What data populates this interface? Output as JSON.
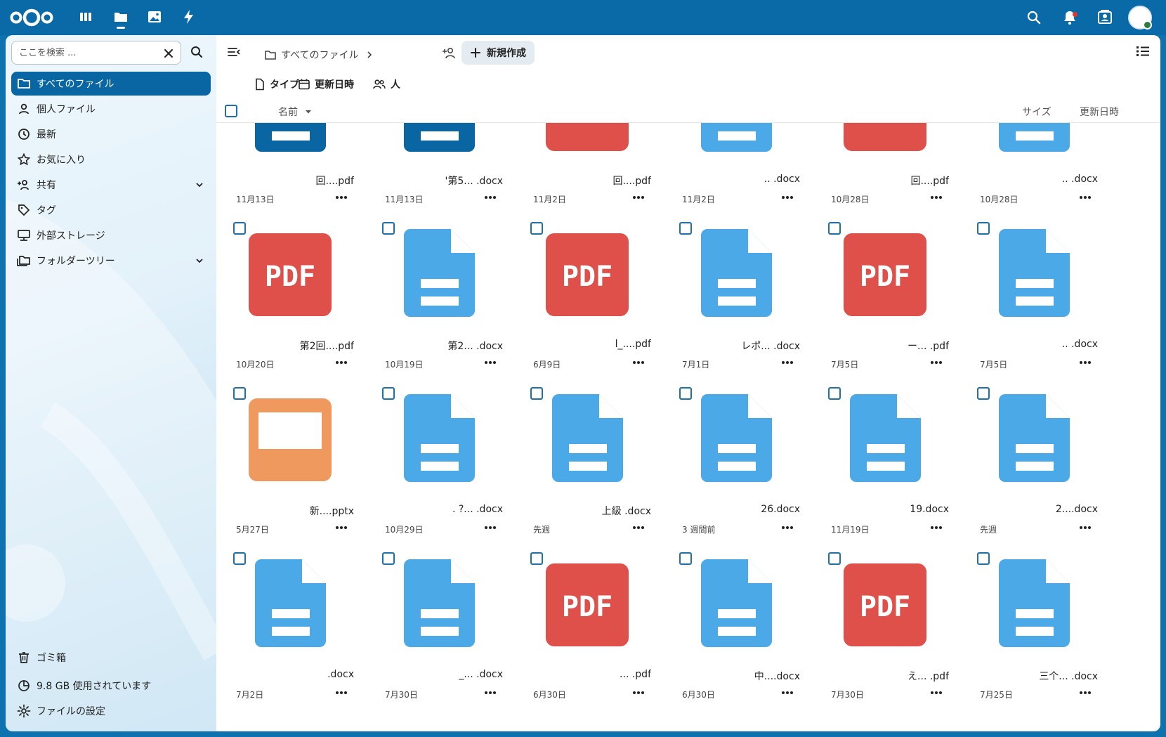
{
  "header": {
    "apps": [
      "dashboard-app",
      "files-app",
      "photos-app",
      "activity-app"
    ],
    "colors": {
      "header": "#0a6aa8",
      "accent": "#0a66a2",
      "pdf": "#e0504a",
      "doc": "#4aa9e6",
      "slide": "#f0995f"
    }
  },
  "search": {
    "placeholder": "ここを検索 ..."
  },
  "sidebar": {
    "items": [
      {
        "label": "すべてのファイル"
      },
      {
        "label": "個人ファイル"
      },
      {
        "label": "最新"
      },
      {
        "label": "お気に入り"
      },
      {
        "label": "共有"
      },
      {
        "label": "タグ"
      },
      {
        "label": "外部ストレージ"
      },
      {
        "label": "フォルダーツリー"
      }
    ],
    "trash": "ゴミ箱",
    "quota": "9.8 GB 使用されています",
    "settings": "ファイルの設定"
  },
  "toolbar": {
    "breadcrumb_root": "すべてのファイル",
    "new_label": "新規作成"
  },
  "filters": {
    "type": "タイプ",
    "modified": "更新日時",
    "people": "人"
  },
  "columns": {
    "name": "名前",
    "size": "サイズ",
    "modified": "更新日時"
  },
  "files": [
    {
      "type": "doc-dark",
      "name": "回....pdf",
      "date": "11月13日"
    },
    {
      "type": "doc-dark",
      "name": "'第5... .docx",
      "date": "11月13日"
    },
    {
      "type": "pdf",
      "name": "回....pdf",
      "date": "11月2日"
    },
    {
      "type": "doc",
      "name": ".. .docx",
      "date": "11月2日"
    },
    {
      "type": "pdf",
      "name": "回....pdf",
      "date": "10月28日"
    },
    {
      "type": "doc",
      "name": ".. .docx",
      "date": "10月28日"
    },
    {
      "type": "pdf",
      "name": "第2回....pdf",
      "date": "10月20日"
    },
    {
      "type": "doc",
      "name": "第2... .docx",
      "date": "10月19日"
    },
    {
      "type": "pdf",
      "name": "l_....pdf",
      "date": "6月9日"
    },
    {
      "type": "doc",
      "name": "レポ... .docx",
      "date": "7月1日"
    },
    {
      "type": "pdf",
      "name": "ー... .pdf",
      "date": "7月5日"
    },
    {
      "type": "doc",
      "name": ".. .docx",
      "date": "7月5日"
    },
    {
      "type": "slide",
      "name": "新....pptx",
      "date": "5月27日"
    },
    {
      "type": "doc",
      "name": ".       ?... .docx",
      "date": "10月29日"
    },
    {
      "type": "doc",
      "name": "上級                  .docx",
      "date": "先週"
    },
    {
      "type": "doc",
      "name": "26.docx",
      "date": "3 週間前"
    },
    {
      "type": "doc",
      "name": "19.docx",
      "date": "11月19日"
    },
    {
      "type": "doc",
      "name": "2....docx",
      "date": "先週"
    },
    {
      "type": "doc",
      "name": ".docx",
      "date": "7月2日"
    },
    {
      "type": "doc",
      "name": "_... .docx",
      "date": "7月30日"
    },
    {
      "type": "pdf",
      "name": "... .pdf",
      "date": "6月30日"
    },
    {
      "type": "doc",
      "name": "中....docx",
      "date": "6月30日"
    },
    {
      "type": "pdf",
      "name": "え... .pdf",
      "date": "7月30日"
    },
    {
      "type": "doc",
      "name": "三个... .docx",
      "date": "7月25日"
    }
  ],
  "pdf_badge": "PDF"
}
